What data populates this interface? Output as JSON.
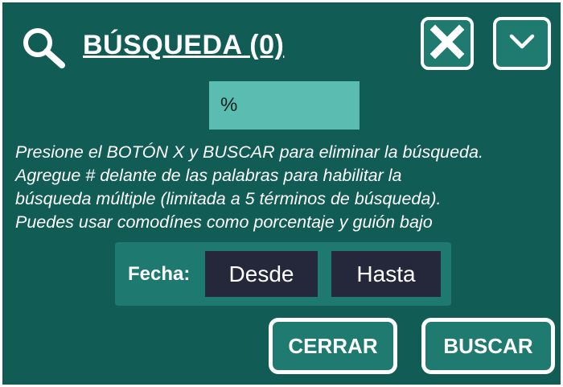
{
  "header": {
    "title": "BÚSQUEDA (0)",
    "search_icon": "search-icon",
    "close_icon": "close-icon",
    "collapse_icon": "chevron-down-icon"
  },
  "search": {
    "value": "%"
  },
  "help": {
    "lines": [
      "Presione el BOTÓN X y BUSCAR para eliminar la búsqueda.",
      "Agregue # delante de las palabras para habilitar la",
      "búsqueda múltiple (limitada a 5 términos de búsqueda).",
      "Puedes usar comodínes como porcentaje y guión bajo"
    ]
  },
  "date_filter": {
    "label": "Fecha:",
    "from": "Desde",
    "to": "Hasta"
  },
  "actions": {
    "close": "CERRAR",
    "search": "BUSCAR"
  },
  "colors": {
    "background": "#125c56",
    "input_bg": "#5bbcb1",
    "button_bg": "#1f7a70",
    "date_button_bg": "#25283a",
    "text": "#ffffff"
  }
}
